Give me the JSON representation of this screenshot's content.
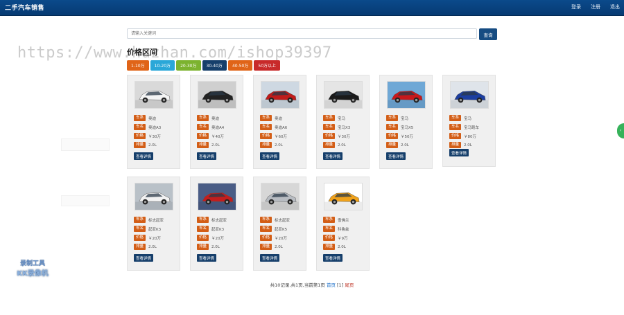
{
  "header": {
    "title": "二手汽车销售",
    "nav": [
      "登录",
      "注册",
      "退出"
    ]
  },
  "search": {
    "placeholder": "请输入关键词",
    "button_label": "查询"
  },
  "watermark": "https://www.huzhan.com/ishop39397",
  "price_filter": {
    "title": "价格区间",
    "options": [
      {
        "label": "1-10万",
        "color": "#e06418"
      },
      {
        "label": "10-20万",
        "color": "#2aa7d8"
      },
      {
        "label": "20-30万",
        "color": "#7cb32f"
      },
      {
        "label": "30-40万",
        "color": "#163f6b"
      },
      {
        "label": "40-50万",
        "color": "#e06418"
      },
      {
        "label": "50万以上",
        "color": "#c82a2a"
      }
    ]
  },
  "field_labels": {
    "brand": "车系",
    "model": "车名",
    "price": "价格",
    "engine": "排量"
  },
  "detail_label": "查看详情",
  "cars": [
    {
      "brand": "奥迪",
      "model": "奥迪A3",
      "price": "￥30万",
      "engine": "2.0L",
      "car_color": "#f4f4f4",
      "bg": "#d9d9d9"
    },
    {
      "brand": "奥迪",
      "model": "奥迪A4",
      "price": "￥40万",
      "engine": "2.0L",
      "car_color": "#222222",
      "bg": "#cfcfcf"
    },
    {
      "brand": "奥迪",
      "model": "奥迪A6",
      "price": "￥60万",
      "engine": "2.0L",
      "car_color": "#c01b1b",
      "bg": "#ced8e2"
    },
    {
      "brand": "宝马",
      "model": "宝马X3",
      "price": "￥30万",
      "engine": "2.0L",
      "car_color": "#1a1a1a",
      "bg": "#e5e5e5"
    },
    {
      "brand": "宝马",
      "model": "宝马X5",
      "price": "￥50万",
      "engine": "2.0L",
      "car_color": "#c7181c",
      "bg": "#6fa8d6"
    },
    {
      "brand": "宝马",
      "model": "宝马跑车",
      "price": "￥80万",
      "engine": "2.0L",
      "car_color": "#1c3ea0",
      "bg": "#dfe4ea"
    },
    {
      "brand": "标志起亚",
      "model": "起亚K3",
      "price": "￥20万",
      "engine": "2.0L",
      "car_color": "#f2f2f2",
      "bg": "#b9c1c8"
    },
    {
      "brand": "标志起亚",
      "model": "起亚K3",
      "price": "￥20万",
      "engine": "2.0L",
      "car_color": "#c41d1d",
      "bg": "#4a5d86"
    },
    {
      "brand": "标志起亚",
      "model": "起亚K5",
      "price": "￥20万",
      "engine": "2.0L",
      "car_color": "#b8bcc2",
      "bg": "#d7d7d7"
    },
    {
      "brand": "雪佛兰",
      "model": "科鲁兹",
      "price": "￥9万",
      "engine": "2.0L",
      "car_color": "#f0a21b",
      "bg": "#ffffff"
    }
  ],
  "pagination": {
    "summary": "共10记录,共1页,当前第1页",
    "first": "首页",
    "current": "[1]",
    "last": "尾页"
  },
  "badge": {
    "line1": "录制工具",
    "line2": "KK录像机"
  }
}
